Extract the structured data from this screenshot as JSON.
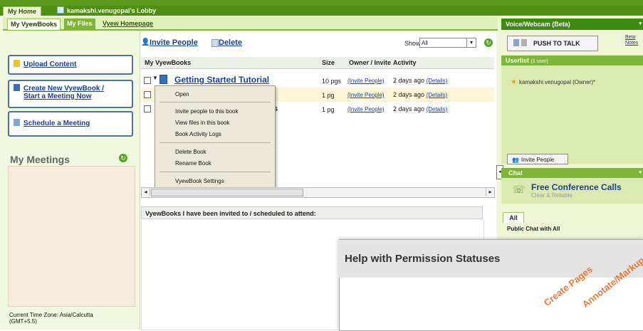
{
  "top_tabs": {
    "home": "My Home",
    "lobby": "kamakshi.venugopal's Lobby"
  },
  "sub_tabs": {
    "books": "My VyewBooks",
    "files": "My Files",
    "homepage": "Vyew Homepage"
  },
  "left": {
    "upload": "Upload Content",
    "create_line1": "Create New VyewBook /",
    "create_line2": "Start a Meeting Now",
    "schedule": "Schedule a Meeting",
    "meetings_title": "My Meetings",
    "timezone_line1": "Current Time Zone: Asia/Calcutta",
    "timezone_line2": "(GMT+5.5)"
  },
  "toolbar": {
    "invite": "Invite People",
    "delete": "Delete",
    "show_label": "Show:",
    "show_value": "All"
  },
  "table": {
    "headers": {
      "book": "My VyewBooks",
      "size": "Size",
      "owner": "Owner / Invite",
      "activity": "Activity"
    },
    "rows": [
      {
        "title": "Getting Started Tutorial",
        "size": "10 pgs",
        "owner": "(Invite People)",
        "activity": "2 days ago",
        "details": "(Details)"
      },
      {
        "title": "",
        "size": "1 pg",
        "owner": "(Invite People)",
        "activity": "2 days ago",
        "details": "(Details)"
      },
      {
        "title": "",
        "tail": "s",
        "size": "1 pg",
        "owner": "(Invite People)",
        "activity": "2 days ago",
        "details": "(Details)"
      }
    ]
  },
  "context_menu": {
    "open": "Open",
    "invite": "Invite people to this book",
    "view_files": "View files in this book",
    "activity_logs": "Book Activity Logs",
    "delete": "Delete Book",
    "rename": "Rename Book",
    "settings": "VyewBook Settings"
  },
  "invited_header": "VyewBooks I have been invited to / scheduled to attend:",
  "right": {
    "voice_title": "Voice/Webcam (Beta)",
    "push_to_talk": "PUSH TO TALK",
    "beta_line1": "Beta",
    "beta_line2": "Notes",
    "userlist_title": "Userlist",
    "userlist_count": "(1 user)",
    "user1": "kamakshi.venugopal (Owner)*",
    "invite_button": "Invite People",
    "chat_title": "Chat",
    "ad_title": "Free Conference Calls",
    "ad_sub": "Clear & Reliable",
    "chat_tab": "All",
    "chat_header": "Public Chat with All"
  },
  "help": {
    "title": "Help with Permission Statuses",
    "diag1": "Create Pages",
    "diag2": "Annotate/Markup"
  }
}
